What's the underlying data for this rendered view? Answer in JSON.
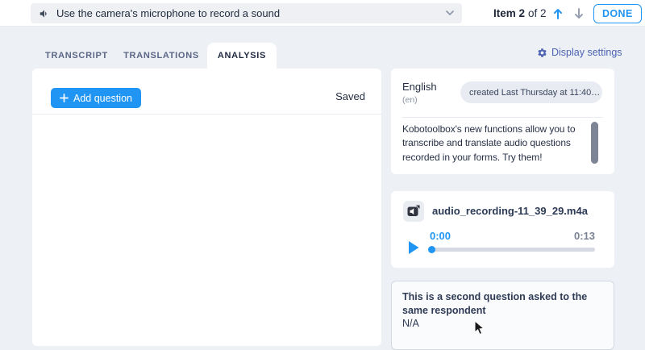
{
  "colors": {
    "accent_blue": "#2095f3",
    "link_indigo": "#4d62b3",
    "page_background": "#edf0f5",
    "panel_background": "#ffffff"
  },
  "top_bar": {
    "audio_question_label": "Use the camera's microphone to record a sound",
    "item_counter_bold": "Item 2",
    "item_counter_rest": "of 2",
    "done_label": "DONE"
  },
  "tabs": [
    {
      "label": "TRANSCRIPT",
      "active": false
    },
    {
      "label": "TRANSLATIONS",
      "active": false
    },
    {
      "label": "ANALYSIS",
      "active": true
    }
  ],
  "header": {
    "display_settings_label": "Display settings"
  },
  "analysis_panel": {
    "add_question_label": "Add question",
    "saved_label": "Saved"
  },
  "language_card": {
    "language": "English",
    "code": "(en)",
    "created_badge": "created Last Thursday at 11:40…",
    "transcript_text": "Kobotoolbox's new functions allow you to transcribe and translate audio questions recorded in your forms. Try them!"
  },
  "audio_card": {
    "filename": "audio_recording-11_39_29.m4a",
    "current_time": "0:00",
    "duration": "0:13"
  },
  "question_card": {
    "question": "This is a second question asked to the same respondent",
    "answer": "N/A"
  }
}
